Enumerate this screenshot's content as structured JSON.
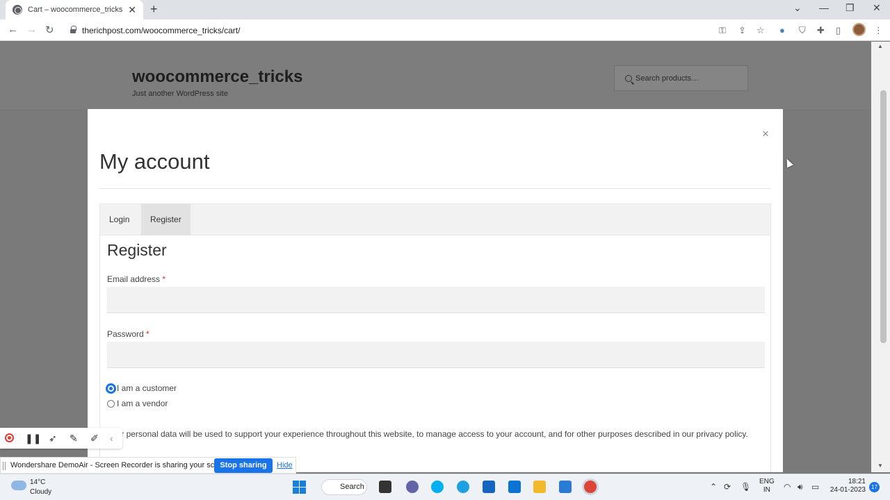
{
  "browser": {
    "tab_title": "Cart – woocommerce_tricks",
    "url": "therichpost.com/woocommerce_tricks/cart/"
  },
  "site": {
    "title": "woocommerce_tricks",
    "tagline": "Just another WordPress site",
    "search_placeholder": "Search products…"
  },
  "modal": {
    "title": "My account",
    "close": "×",
    "tabs": [
      {
        "label": "Login",
        "active": false
      },
      {
        "label": "Register",
        "active": true
      }
    ],
    "register": {
      "title": "Register",
      "email_label": "Email address",
      "email_value": "",
      "password_label": "Password",
      "password_value": "",
      "required_mark": "*",
      "roles": [
        {
          "label": "I am a customer",
          "checked": true
        },
        {
          "label": "I am a vendor",
          "checked": false
        }
      ],
      "privacy_text": "Your personal data will be used to support your experience throughout this website, to manage access to your account, and for other purposes described in our privacy policy."
    }
  },
  "recorder": {
    "share_text": "Wondershare DemoAir - Screen Recorder is sharing your screen.",
    "stop_label": "Stop sharing",
    "hide_label": "Hide"
  },
  "taskbar": {
    "temperature": "14°C",
    "weather": "Cloudy",
    "search_label": "Search",
    "lang_line1": "ENG",
    "lang_line2": "IN",
    "time": "18:21",
    "date": "24-01-2023",
    "notification_count": "17"
  },
  "colors": {
    "accent": "#1a73e8",
    "overlay": "#7a7a7a",
    "required": "#c0392b"
  }
}
